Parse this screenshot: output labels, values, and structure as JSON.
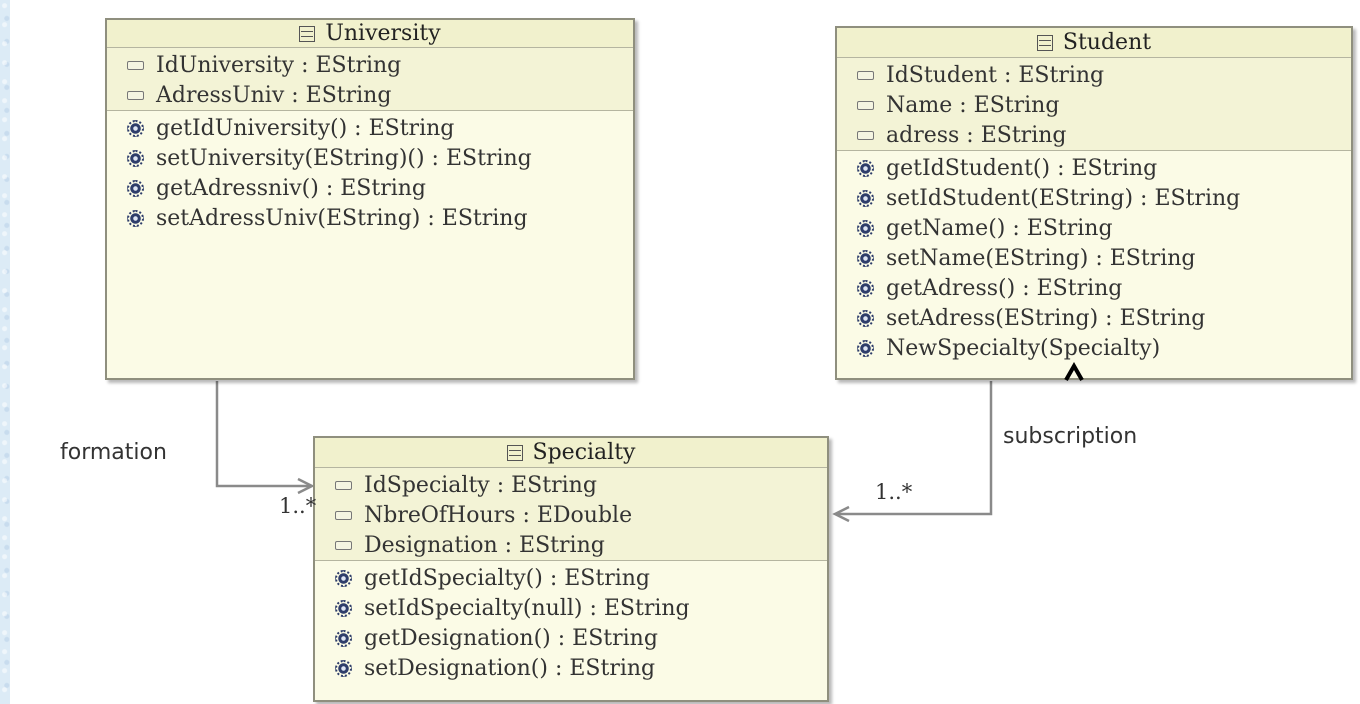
{
  "classes": {
    "university": {
      "name": "University",
      "attributes": [
        "IdUniversity : EString",
        "AdressUniv : EString"
      ],
      "operations": [
        "getIdUniversity() : EString",
        "setUniversity(EString)() : EString",
        "getAdressniv() : EString",
        "setAdressUniv(EString) : EString"
      ]
    },
    "student": {
      "name": "Student",
      "attributes": [
        "IdStudent : EString",
        "Name : EString",
        "adress : EString"
      ],
      "operations": [
        "getIdStudent() : EString",
        "setIdStudent(EString) : EString",
        "getName() : EString",
        "setName(EString) : EString",
        "getAdress() : EString",
        "setAdress(EString) : EString",
        "NewSpecialty(Specialty)"
      ]
    },
    "specialty": {
      "name": "Specialty",
      "attributes": [
        "IdSpecialty : EString",
        "NbreOfHours : EDouble",
        "Designation : EString"
      ],
      "operations": [
        "getIdSpecialty() : EString",
        "setIdSpecialty(null) : EString",
        "getDesignation() : EString",
        "setDesignation() : EString"
      ]
    }
  },
  "associations": {
    "formation": {
      "label": "formation",
      "multiplicity": "1..*"
    },
    "subscription": {
      "label": "subscription",
      "multiplicity": "1..*"
    }
  },
  "colors": {
    "box_fill": "#fbfbe6",
    "header_fill": "#f1f1cd",
    "border": "#8f8f7e",
    "connector": "#8a8a8a",
    "operation_icon": "#2e3d6a"
  }
}
